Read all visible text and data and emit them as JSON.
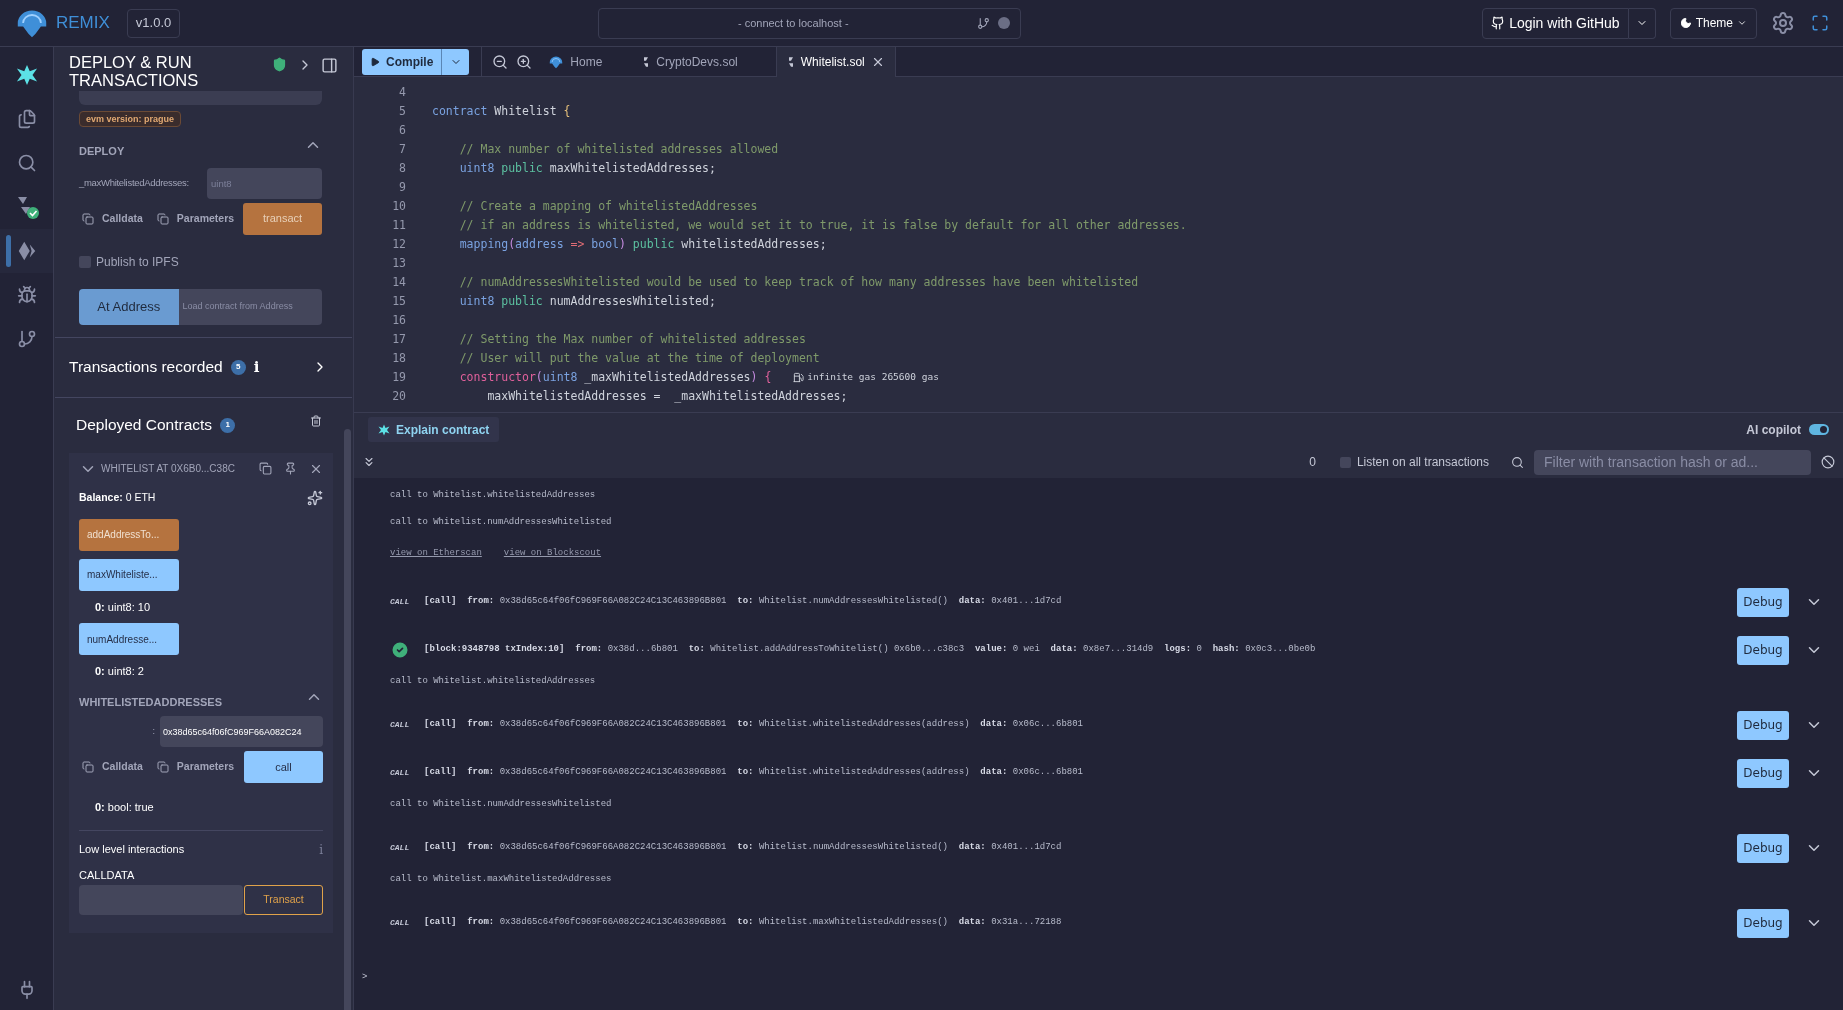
{
  "topbar": {
    "logo": "REMIX",
    "version": "v1.0.0",
    "connection": "- connect to localhost -",
    "login": "Login with GitHub",
    "theme": "Theme"
  },
  "icon_rail": [
    {
      "kind": "ai",
      "selected": false
    },
    {
      "kind": "files",
      "selected": false
    },
    {
      "kind": "search",
      "selected": false
    },
    {
      "kind": "compiler",
      "selected": false
    },
    {
      "kind": "deploy",
      "selected": true
    },
    {
      "kind": "debugger",
      "selected": false
    },
    {
      "kind": "git",
      "selected": false
    }
  ],
  "panel": {
    "title": "DEPLOY & RUN TRANSACTIONS",
    "evm_badge": "evm version: prague",
    "deploy": {
      "heading": "DEPLOY",
      "expanded": true,
      "param_label": "_maxWhitelistedAddresses:",
      "param_placeholder": "uint8",
      "calldata": "Calldata",
      "parameters": "Parameters",
      "transact": "transact"
    },
    "publish": {
      "label": "Publish to IPFS",
      "checked": false
    },
    "at_address": {
      "button": "At Address",
      "placeholder": "Load contract from Address"
    },
    "transactions_recorded": {
      "label": "Transactions recorded",
      "count": "5",
      "info": "i"
    },
    "deployed": {
      "label": "Deployed Contracts",
      "count": "1",
      "contract": {
        "title": "WHITELIST AT 0X6B0...C38C",
        "expanded": true,
        "balance": "**Balance:** 0 ETH",
        "functions": [
          {
            "kind": "transact",
            "label": "addAddressTo..."
          },
          {
            "kind": "call",
            "label": "maxWhiteliste...",
            "result": "**0:** uint8: 10"
          },
          {
            "kind": "call",
            "label": "numAddresse...",
            "result": "**0:** uint8: 2"
          }
        ],
        "open_function": {
          "heading": "WHITELISTEDADDRESSES",
          "expanded": true,
          "arg_label": ":",
          "arg_value": "0x38d65c64f06fC969F66A082C24",
          "calldata": "Calldata",
          "parameters": "Parameters",
          "call": "call",
          "result": "**0:** bool: true"
        },
        "low_level": {
          "label": "Low level interactions",
          "info": "i",
          "calldata_label": "CALLDATA",
          "transact": "Transact"
        }
      }
    }
  },
  "editor": {
    "compile": "Compile",
    "tabs": [
      {
        "kind": "home",
        "label": "Home",
        "selected": false
      },
      {
        "kind": "file",
        "label": "CryptoDevs.sol",
        "selected": false
      },
      {
        "kind": "file",
        "label": "Whitelist.sol",
        "selected": true
      }
    ],
    "lines": [
      {
        "number": "4"
      },
      {
        "number": "5",
        "tokens": [
          {
            "kind": "keyword",
            "text": "contract"
          },
          {
            "kind": "ident",
            "text": " Whitelist "
          },
          {
            "kind": "brace",
            "text": "{"
          }
        ]
      },
      {
        "number": "6"
      },
      {
        "number": "7",
        "tokens": [
          {
            "kind": "comment",
            "text": "    // Max number of whitelisted addresses allowed"
          }
        ]
      },
      {
        "number": "8",
        "tokens": [
          {
            "kind": "type",
            "text": "    uint8"
          },
          {
            "kind": "modifier",
            "text": " public"
          },
          {
            "kind": "ident",
            "text": " maxWhitelistedAddresses;"
          }
        ]
      },
      {
        "number": "9"
      },
      {
        "number": "10",
        "tokens": [
          {
            "kind": "comment",
            "text": "    // Create a mapping of whitelistedAddresses"
          }
        ]
      },
      {
        "number": "11",
        "tokens": [
          {
            "kind": "comment",
            "text": "    // if an address is whitelisted, we would set it to true, it is false by default for all other addresses."
          }
        ]
      },
      {
        "number": "12",
        "tokens": [
          {
            "kind": "type",
            "text": "    mapping"
          },
          {
            "kind": "paren",
            "text": "("
          },
          {
            "kind": "type",
            "text": "address"
          },
          {
            "kind": "op",
            "text": " => "
          },
          {
            "kind": "type",
            "text": "bool"
          },
          {
            "kind": "paren",
            "text": ")"
          },
          {
            "kind": "modifier",
            "text": " public"
          },
          {
            "kind": "ident",
            "text": " whitelistedAddresses;"
          }
        ]
      },
      {
        "number": "13"
      },
      {
        "number": "14",
        "tokens": [
          {
            "kind": "comment",
            "text": "    // numAddressesWhitelisted would be used to keep track of how many addresses have been whitelisted"
          }
        ]
      },
      {
        "number": "15",
        "tokens": [
          {
            "kind": "type",
            "text": "    uint8"
          },
          {
            "kind": "modifier",
            "text": " public"
          },
          {
            "kind": "ident",
            "text": " numAddressesWhitelisted;"
          }
        ]
      },
      {
        "number": "16"
      },
      {
        "number": "17",
        "tokens": [
          {
            "kind": "comment",
            "text": "    // Setting the Max number of whitelisted addresses"
          }
        ]
      },
      {
        "number": "18",
        "tokens": [
          {
            "kind": "comment",
            "text": "    // User will put the value at the time of deployment"
          }
        ]
      },
      {
        "number": "19",
        "tokens": [
          {
            "kind": "func",
            "text": "    constructor"
          },
          {
            "kind": "paren",
            "text": "("
          },
          {
            "kind": "type",
            "text": "uint8"
          },
          {
            "kind": "ident",
            "text": " _maxWhitelistedAddresses"
          },
          {
            "kind": "paren",
            "text": ")"
          },
          {
            "kind": "func",
            "text": " {"
          }
        ],
        "hint": "infinite gas 265600 gas"
      },
      {
        "number": "20",
        "tokens": [
          {
            "kind": "ident",
            "text": "        maxWhitelistedAddresses =  _maxWhitelistedAddresses;"
          }
        ]
      }
    ]
  },
  "terminal": {
    "explain": "Explain contract",
    "copilot": {
      "label": "AI copilot",
      "on": true
    },
    "count": "0",
    "listen": {
      "label": "Listen on all transactions",
      "checked": false
    },
    "filter_placeholder": "Filter with transaction hash or ad...",
    "rows": [
      {
        "kind": "log",
        "text": "call to Whitelist.whitelistedAddresses"
      },
      {
        "kind": "log",
        "text": "call to Whitelist.numAddressesWhitelisted"
      },
      {
        "kind": "links",
        "links": [
          "view on Etherscan",
          "view on Blockscout"
        ]
      },
      {
        "kind": "call",
        "badge": "CALL",
        "head": "[call]",
        "fields": [
          {
            "label": "from:",
            "value": "0x38d65c64f06fC969F66A082C24C13C463896B801"
          },
          {
            "label": "to:",
            "value": "Whitelist.numAddressesWhitelisted()"
          },
          {
            "label": "data:",
            "value": "0x401...1d7cd"
          }
        ],
        "debug": "Debug"
      },
      {
        "kind": "tx",
        "head": "[block:9348798 txIndex:10]",
        "fields": [
          {
            "label": "from:",
            "value": "0x38d...6b801"
          },
          {
            "label": "to:",
            "value": "Whitelist.addAddressToWhitelist() 0x6b0...c38c3"
          },
          {
            "label": "value:",
            "value": "0 wei"
          },
          {
            "label": "data:",
            "value": "0x8e7...314d9"
          },
          {
            "label": "logs:",
            "value": "0"
          },
          {
            "label": "hash:",
            "value": "0x0c3...0be0b"
          }
        ],
        "debug": "Debug"
      },
      {
        "kind": "log",
        "text": "call to Whitelist.whitelistedAddresses"
      },
      {
        "kind": "call",
        "badge": "CALL",
        "head": "[call]",
        "fields": [
          {
            "label": "from:",
            "value": "0x38d65c64f06fC969F66A082C24C13C463896B801"
          },
          {
            "label": "to:",
            "value": "Whitelist.whitelistedAddresses(address)"
          },
          {
            "label": "data:",
            "value": "0x06c...6b801"
          }
        ],
        "debug": "Debug"
      },
      {
        "kind": "call",
        "badge": "CALL",
        "head": "[call]",
        "fields": [
          {
            "label": "from:",
            "value": "0x38d65c64f06fC969F66A082C24C13C463896B801"
          },
          {
            "label": "to:",
            "value": "Whitelist.whitelistedAddresses(address)"
          },
          {
            "label": "data:",
            "value": "0x06c...6b801"
          }
        ],
        "debug": "Debug"
      },
      {
        "kind": "log",
        "text": "call to Whitelist.numAddressesWhitelisted"
      },
      {
        "kind": "call",
        "badge": "CALL",
        "head": "[call]",
        "fields": [
          {
            "label": "from:",
            "value": "0x38d65c64f06fC969F66A082C24C13C463896B801"
          },
          {
            "label": "to:",
            "value": "Whitelist.numAddressesWhitelisted()"
          },
          {
            "label": "data:",
            "value": "0x401...1d7cd"
          }
        ],
        "debug": "Debug"
      },
      {
        "kind": "log",
        "text": "call to Whitelist.maxWhitelistedAddresses"
      },
      {
        "kind": "call",
        "badge": "CALL",
        "head": "[call]",
        "fields": [
          {
            "label": "from:",
            "value": "0x38d65c64f06fC969F66A082C24C13C463896B801"
          },
          {
            "label": "to:",
            "value": "Whitelist.maxWhitelistedAddresses()"
          },
          {
            "label": "data:",
            "value": "0x31a...72188"
          }
        ],
        "debug": "Debug"
      }
    ],
    "prompt": ">"
  }
}
